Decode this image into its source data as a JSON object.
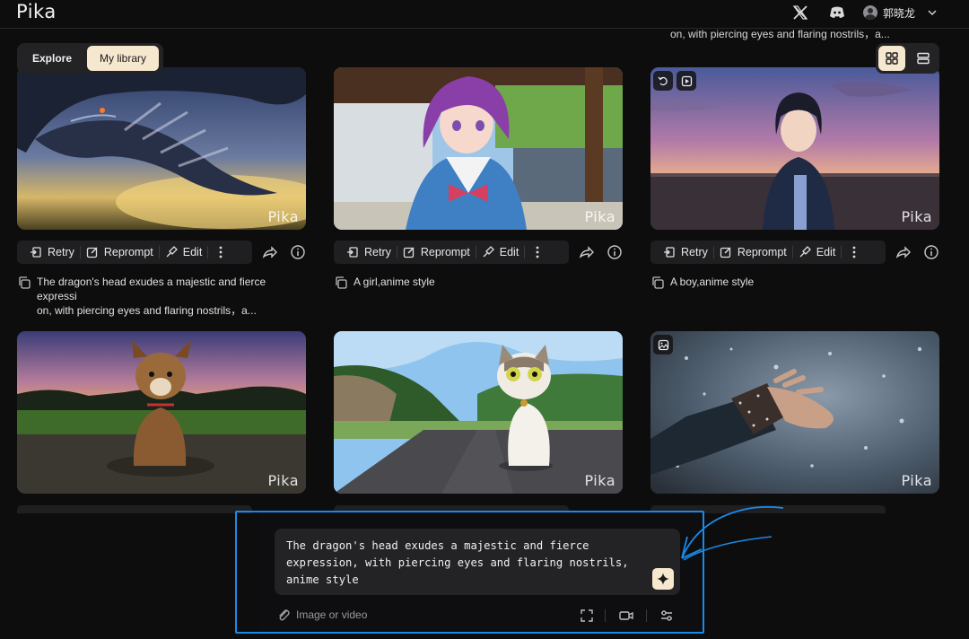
{
  "app": {
    "logo": "Pika"
  },
  "header": {
    "user_name": "郭晓龙"
  },
  "overflow_text": "on, with piercing eyes and flaring nostrils，a...",
  "tabs": [
    {
      "label": "Explore",
      "active": false
    },
    {
      "label": "My library",
      "active": true
    }
  ],
  "view_toggle": {
    "active": "grid"
  },
  "card_actions": {
    "retry": "Retry",
    "reprompt": "Reprompt",
    "edit": "Edit"
  },
  "watermark": "Pika",
  "cards": [
    {
      "prompt_line1": "The dragon's head exudes a majestic and fierce expressi",
      "prompt_line2": "on, with piercing eyes and flaring nostrils，a..."
    },
    {
      "prompt_line1": "A girl,anime style"
    },
    {
      "prompt_line1": "A boy,anime style",
      "badges": [
        "retry-badge-icon",
        "video-badge-icon"
      ]
    },
    {
      "scene": "dog"
    },
    {
      "scene": "cat"
    },
    {
      "scene": "hand-snow",
      "badges": [
        "image-badge-icon"
      ]
    }
  ],
  "composer": {
    "text": "The dragon's head exudes a majestic and fierce\nexpression, with piercing eyes and flaring nostrils,\nanime style",
    "attach_label": "Image or video"
  },
  "colors": {
    "accent": "#f6e7cf",
    "annotation": "#1a8ae8",
    "background": "#0d0d0e"
  }
}
